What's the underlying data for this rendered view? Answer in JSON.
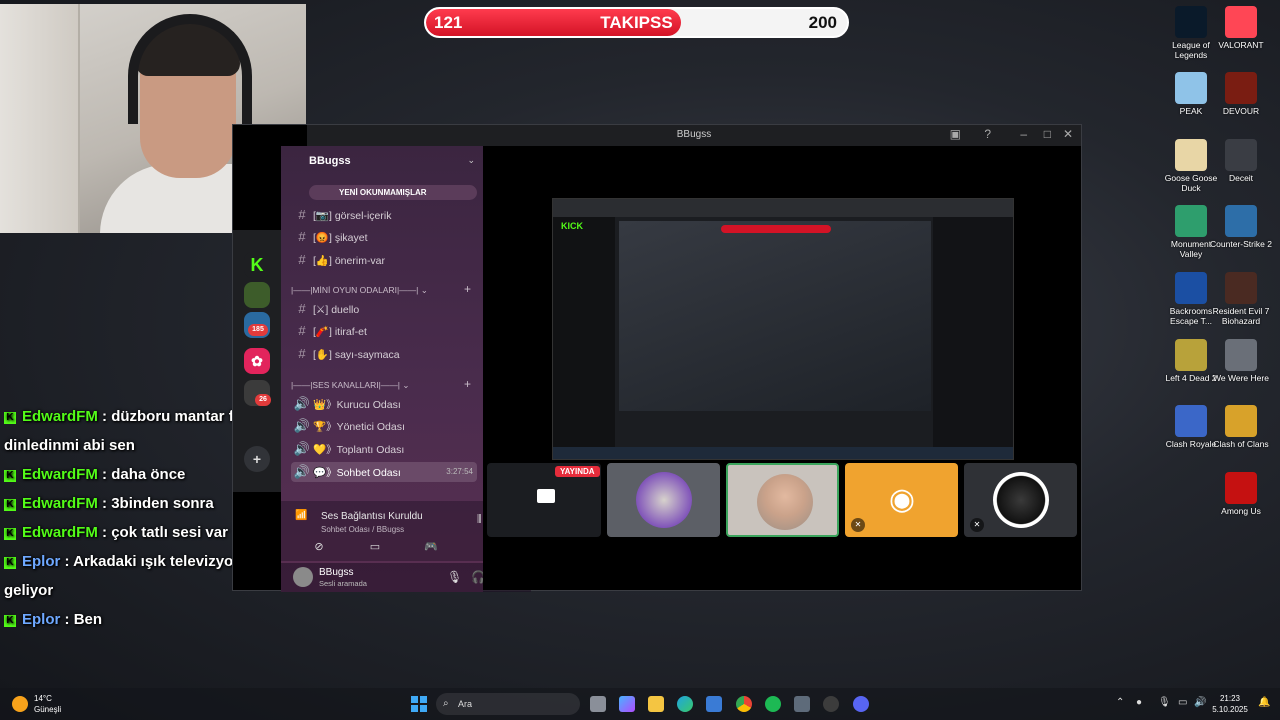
{
  "follower_goal": {
    "current": "121",
    "title": "TAKIPSS",
    "goal": "200",
    "progress": 0.605
  },
  "chat": [
    {
      "user": "EdwardFM",
      "sep": " : ",
      "text": "düzboru mantar filtre dinledinmi abi sen",
      "color": "green"
    },
    {
      "user": "EdwardFM",
      "sep": " : ",
      "text": "daha önce",
      "color": "green"
    },
    {
      "user": "EdwardFM",
      "sep": " : ",
      "text": "3binden sonra",
      "color": "green"
    },
    {
      "user": "EdwardFM",
      "sep": " : ",
      "text": "çok tatlı sesi var",
      "color": "green"
    },
    {
      "user": "Eplor",
      "sep": " : ",
      "text": "Arkadaki ışık televizyonla mı geliyor",
      "color": "blue"
    },
    {
      "user": "Eplor",
      "sep": " : ",
      "text": "Ben",
      "color": "blue"
    }
  ],
  "discord": {
    "window_title": "BBugss",
    "server_name": "BBugss",
    "unread_label": "YENİ OKUNMAMIŞLAR",
    "guild_badges": {
      "g1": "185",
      "g2": "26"
    },
    "channels": [
      {
        "name": "görsel-içerik",
        "emoji": "📷"
      },
      {
        "name": "şikayet",
        "emoji": "😡"
      },
      {
        "name": "önerim-var",
        "emoji": "👍"
      }
    ],
    "category_games": "MİNİ OYUN ODALARI",
    "game_channels": [
      {
        "name": "duello",
        "emoji": "⚔"
      },
      {
        "name": "itiraf-et",
        "emoji": "🧨"
      },
      {
        "name": "sayı-saymaca",
        "emoji": "✋"
      }
    ],
    "category_voice": "SES KANALLARI",
    "voice_channels": [
      {
        "name": "Kurucu Odası",
        "emoji": "👑"
      },
      {
        "name": "Yönetici Odası",
        "emoji": "🏆"
      },
      {
        "name": "Toplantı Odası",
        "emoji": "💛"
      },
      {
        "name": "Sohbet Odası",
        "emoji": "💬",
        "time": "3:27:54",
        "active": true
      }
    ],
    "voice_status": "Ses Bağlantısı Kuruldu",
    "voice_channel_path": "Sohbet Odası / BBugss",
    "user": {
      "name": "BBugss",
      "status": "Sesli aramada"
    },
    "live_badge": "YAYINDA"
  },
  "desktop_icons": [
    {
      "label": "League of Legends",
      "color": "#0a1a2a"
    },
    {
      "label": "VALORANT",
      "color": "#ff4655"
    },
    {
      "label": "PEAK",
      "color": "#8fc3e8"
    },
    {
      "label": "DEVOUR",
      "color": "#7a1d12"
    },
    {
      "label": "Goose Goose Duck",
      "color": "#e8d6a6"
    },
    {
      "label": "Deceit",
      "color": "#3a3d44"
    },
    {
      "label": "Monument Valley",
      "color": "#2e9e6d"
    },
    {
      "label": "Counter-Strike 2",
      "color": "#2d6ea8"
    },
    {
      "label": "Backrooms Escape T...",
      "color": "#1b4fa3"
    },
    {
      "label": "Resident Evil 7 Biohazard",
      "color": "#4a2a22"
    },
    {
      "label": "Left 4 Dead 2",
      "color": "#b8a23a"
    },
    {
      "label": "We Were Here",
      "color": "#6a6f78"
    },
    {
      "label": "Clash Royale",
      "color": "#3b67c8"
    },
    {
      "label": "Clash of Clans",
      "color": "#d8a22a"
    },
    {
      "label": "Among Us",
      "color": "#c51111"
    }
  ],
  "taskbar": {
    "temperature": "14°C",
    "weather_desc": "Güneşli",
    "search_placeholder": "Ara",
    "time": "21:23",
    "date": "5.10.2025"
  }
}
